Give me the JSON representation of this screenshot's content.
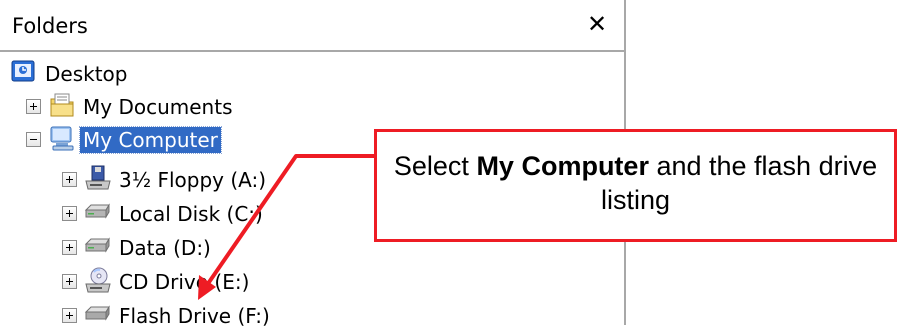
{
  "panel": {
    "title": "Folders",
    "close_symbol": "✕"
  },
  "tree": [
    {
      "label": "Desktop",
      "icon": "desktop-icon",
      "level": 0,
      "expander": "none",
      "selected": false
    },
    {
      "label": "My Documents",
      "icon": "my-documents-icon",
      "level": 1,
      "expander": "plus",
      "selected": false
    },
    {
      "label": "My Computer",
      "icon": "my-computer-icon",
      "level": 1,
      "expander": "minus",
      "selected": true
    },
    {
      "label": "3½ Floppy (A:)",
      "icon": "floppy-drive-icon",
      "level": 2,
      "expander": "plus",
      "selected": false
    },
    {
      "label": "Local Disk (C:)",
      "icon": "hard-drive-icon",
      "level": 2,
      "expander": "plus",
      "selected": false
    },
    {
      "label": "Data (D:)",
      "icon": "hard-drive-icon",
      "level": 2,
      "expander": "plus",
      "selected": false
    },
    {
      "label": "CD Drive (E:)",
      "icon": "cd-drive-icon",
      "level": 2,
      "expander": "plus",
      "selected": false
    },
    {
      "label": "Flash Drive (F:)",
      "icon": "flash-drive-icon",
      "level": 2,
      "expander": "plus",
      "selected": false
    }
  ],
  "callout": {
    "text_before": "Select ",
    "text_bold": "My Computer",
    "text_after": " and the flash drive listing"
  },
  "colors": {
    "selection": "#316ac5",
    "callout_border": "#ee1c24",
    "arrow": "#ee1c24"
  }
}
